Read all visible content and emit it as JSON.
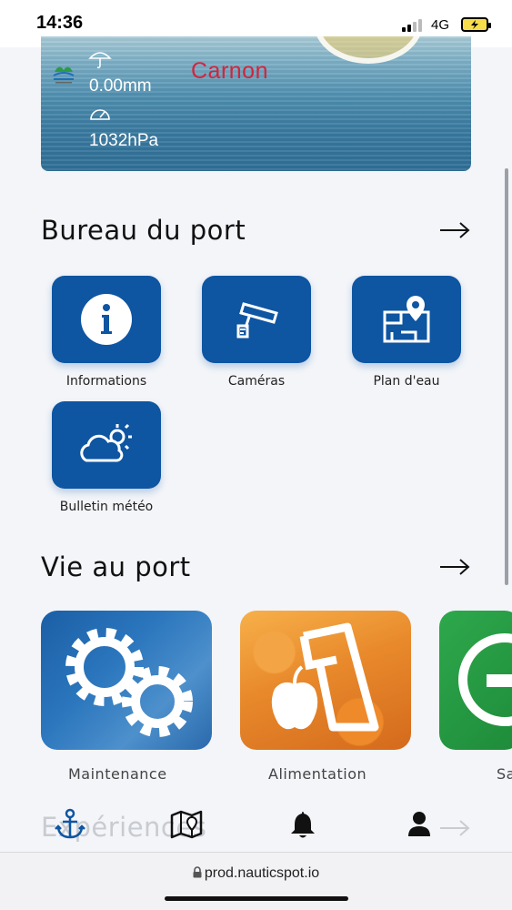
{
  "status_bar": {
    "time": "14:36",
    "network": "4G",
    "battery_state": "charging",
    "battery_color": "#f5dd4b"
  },
  "hero": {
    "title": "Carnon",
    "title_color": "#d4243c",
    "rain_icon": "umbrella-icon",
    "rain_value": "0.00mm",
    "pressure_icon": "gauge-icon",
    "pressure_value": "1032hPa"
  },
  "bureau": {
    "title": "Bureau du port",
    "arrow_icon": "arrow-right-icon",
    "tile_color": "#0e55a2",
    "tiles": [
      {
        "label": "Informations",
        "icon": "info-icon"
      },
      {
        "label": "Caméras",
        "icon": "camera-icon"
      },
      {
        "label": "Plan d'eau",
        "icon": "map-pin-icon"
      },
      {
        "label": "Bulletin météo",
        "icon": "weather-icon"
      }
    ]
  },
  "vie": {
    "title": "Vie au port",
    "arrow_icon": "arrow-right-icon",
    "cards": [
      {
        "label": "Maintenance",
        "icon": "gears-icon"
      },
      {
        "label": "Alimentation",
        "icon": "grocery-icon"
      },
      {
        "label": "Sa",
        "icon": "plus-icon"
      }
    ]
  },
  "experiences": {
    "title": "Expériences"
  },
  "bottom_nav": {
    "items": [
      {
        "icon": "anchor-icon"
      },
      {
        "icon": "map-icon"
      },
      {
        "icon": "bell-icon"
      },
      {
        "icon": "user-icon"
      }
    ],
    "active_color": "#0e55a2"
  },
  "browser": {
    "url": "prod.nauticspot.io"
  }
}
